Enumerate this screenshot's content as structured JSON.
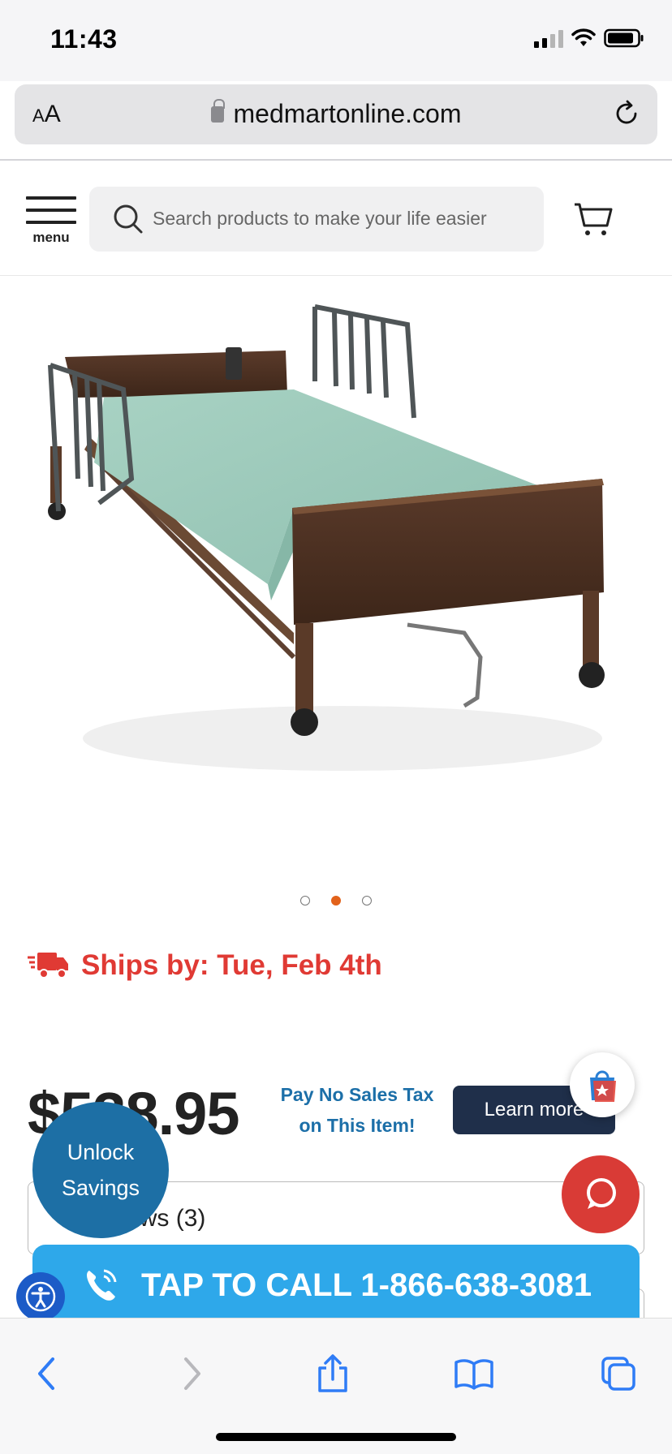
{
  "status_bar": {
    "time": "11:43"
  },
  "browser": {
    "text_size_label": "AA",
    "url": "medmartonline.com"
  },
  "header": {
    "menu_label": "menu",
    "search_placeholder": "Search products to make your life easier"
  },
  "carousel": {
    "slides": 3,
    "active_index": 1
  },
  "shipping": {
    "text": "Ships by: Tue, Feb 4th"
  },
  "pricing": {
    "price": "$538.95",
    "tax_line1": "Pay No Sales Tax",
    "tax_line2": "on This Item!",
    "learn_more": "Learn more"
  },
  "reviews": {
    "label": "Reviews (3)"
  },
  "promo": {
    "line1": "Unlock",
    "line2": "Savings"
  },
  "call": {
    "label": "TAP TO CALL 1-866-638-3081"
  },
  "colors": {
    "ships_red": "#e03a34",
    "tax_blue": "#1c6fa8",
    "learn_navy": "#1f2f4a",
    "call_blue": "#2ea8ea",
    "unlock_blue": "#1d6fa5",
    "chat_red": "#d93b36",
    "dot_active": "#e2621b"
  }
}
